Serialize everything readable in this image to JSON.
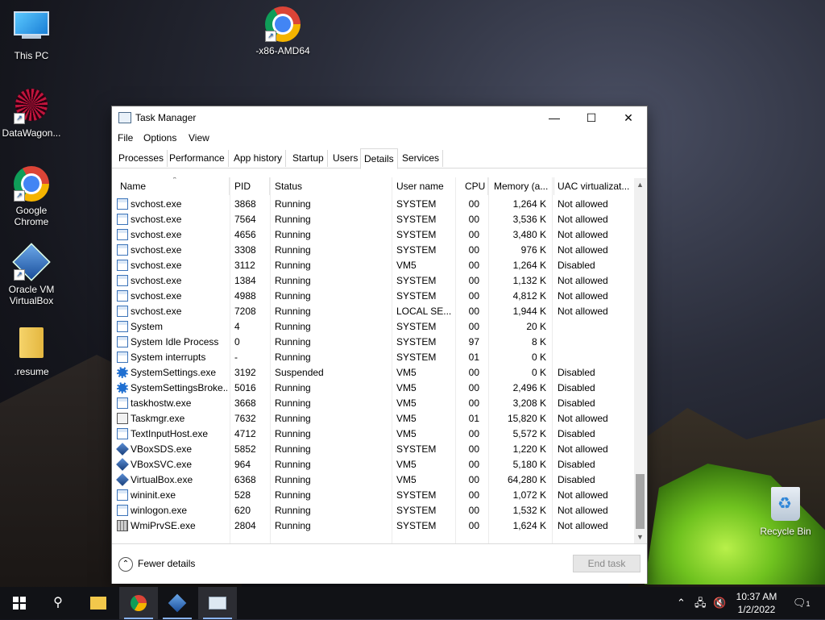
{
  "desktop": {
    "icons": [
      {
        "label": "This PC",
        "icon": "this-pc-icon"
      },
      {
        "label": "-x86-AMD64",
        "icon": "chrome-icon"
      },
      {
        "label": "DataWagon...",
        "icon": "datawagon-icon"
      },
      {
        "label": "Google Chrome",
        "icon": "chrome-icon"
      },
      {
        "label": "Oracle VM VirtualBox",
        "icon": "virtualbox-icon"
      },
      {
        "label": ".resume",
        "icon": "folder-icon"
      },
      {
        "label": "Recycle Bin",
        "icon": "recycle-bin-icon"
      }
    ]
  },
  "window": {
    "title": "Task Manager",
    "menu": [
      "File",
      "Options",
      "View"
    ],
    "tabs": [
      "Processes",
      "Performance",
      "App history",
      "Startup",
      "Users",
      "Details",
      "Services"
    ],
    "active_tab": "Details",
    "columns": [
      "Name",
      "PID",
      "Status",
      "User name",
      "CPU",
      "Memory (a...",
      "UAC virtualizat..."
    ],
    "rows": [
      {
        "name": "svchost.exe",
        "pid": "3868",
        "status": "Running",
        "user": "SYSTEM",
        "cpu": "00",
        "mem": "1,264 K",
        "uac": "Not allowed",
        "icon": "svc"
      },
      {
        "name": "svchost.exe",
        "pid": "7564",
        "status": "Running",
        "user": "SYSTEM",
        "cpu": "00",
        "mem": "3,536 K",
        "uac": "Not allowed",
        "icon": "svc"
      },
      {
        "name": "svchost.exe",
        "pid": "4656",
        "status": "Running",
        "user": "SYSTEM",
        "cpu": "00",
        "mem": "3,480 K",
        "uac": "Not allowed",
        "icon": "svc"
      },
      {
        "name": "svchost.exe",
        "pid": "3308",
        "status": "Running",
        "user": "SYSTEM",
        "cpu": "00",
        "mem": "976 K",
        "uac": "Not allowed",
        "icon": "svc"
      },
      {
        "name": "svchost.exe",
        "pid": "3112",
        "status": "Running",
        "user": "VM5",
        "cpu": "00",
        "mem": "1,264 K",
        "uac": "Disabled",
        "icon": "svc"
      },
      {
        "name": "svchost.exe",
        "pid": "1384",
        "status": "Running",
        "user": "SYSTEM",
        "cpu": "00",
        "mem": "1,132 K",
        "uac": "Not allowed",
        "icon": "svc"
      },
      {
        "name": "svchost.exe",
        "pid": "4988",
        "status": "Running",
        "user": "SYSTEM",
        "cpu": "00",
        "mem": "4,812 K",
        "uac": "Not allowed",
        "icon": "svc"
      },
      {
        "name": "svchost.exe",
        "pid": "7208",
        "status": "Running",
        "user": "LOCAL SE...",
        "cpu": "00",
        "mem": "1,944 K",
        "uac": "Not allowed",
        "icon": "svc"
      },
      {
        "name": "System",
        "pid": "4",
        "status": "Running",
        "user": "SYSTEM",
        "cpu": "00",
        "mem": "20 K",
        "uac": "",
        "icon": "svc"
      },
      {
        "name": "System Idle Process",
        "pid": "0",
        "status": "Running",
        "user": "SYSTEM",
        "cpu": "97",
        "mem": "8 K",
        "uac": "",
        "icon": "svc"
      },
      {
        "name": "System interrupts",
        "pid": "-",
        "status": "Running",
        "user": "SYSTEM",
        "cpu": "01",
        "mem": "0 K",
        "uac": "",
        "icon": "svc"
      },
      {
        "name": "SystemSettings.exe",
        "pid": "3192",
        "status": "Suspended",
        "user": "VM5",
        "cpu": "00",
        "mem": "0 K",
        "uac": "Disabled",
        "icon": "gear"
      },
      {
        "name": "SystemSettingsBroke...",
        "pid": "5016",
        "status": "Running",
        "user": "VM5",
        "cpu": "00",
        "mem": "2,496 K",
        "uac": "Disabled",
        "icon": "gear"
      },
      {
        "name": "taskhostw.exe",
        "pid": "3668",
        "status": "Running",
        "user": "VM5",
        "cpu": "00",
        "mem": "3,208 K",
        "uac": "Disabled",
        "icon": "svc"
      },
      {
        "name": "Taskmgr.exe",
        "pid": "7632",
        "status": "Running",
        "user": "VM5",
        "cpu": "01",
        "mem": "15,820 K",
        "uac": "Not allowed",
        "icon": "task"
      },
      {
        "name": "TextInputHost.exe",
        "pid": "4712",
        "status": "Running",
        "user": "VM5",
        "cpu": "00",
        "mem": "5,572 K",
        "uac": "Disabled",
        "icon": "svc"
      },
      {
        "name": "VBoxSDS.exe",
        "pid": "5852",
        "status": "Running",
        "user": "SYSTEM",
        "cpu": "00",
        "mem": "1,220 K",
        "uac": "Not allowed",
        "icon": "vbox"
      },
      {
        "name": "VBoxSVC.exe",
        "pid": "964",
        "status": "Running",
        "user": "VM5",
        "cpu": "00",
        "mem": "5,180 K",
        "uac": "Disabled",
        "icon": "vbox"
      },
      {
        "name": "VirtualBox.exe",
        "pid": "6368",
        "status": "Running",
        "user": "VM5",
        "cpu": "00",
        "mem": "64,280 K",
        "uac": "Disabled",
        "icon": "vbox"
      },
      {
        "name": "wininit.exe",
        "pid": "528",
        "status": "Running",
        "user": "SYSTEM",
        "cpu": "00",
        "mem": "1,072 K",
        "uac": "Not allowed",
        "icon": "svc"
      },
      {
        "name": "winlogon.exe",
        "pid": "620",
        "status": "Running",
        "user": "SYSTEM",
        "cpu": "00",
        "mem": "1,532 K",
        "uac": "Not allowed",
        "icon": "svc"
      },
      {
        "name": "WmiPrvSE.exe",
        "pid": "2804",
        "status": "Running",
        "user": "SYSTEM",
        "cpu": "00",
        "mem": "1,624 K",
        "uac": "Not allowed",
        "icon": "wmi"
      }
    ],
    "footer": {
      "fewer_details": "Fewer details",
      "end_task": "End task"
    }
  },
  "taskbar": {
    "pinned": [
      "start-icon",
      "search-icon",
      "file-explorer-icon",
      "chrome-icon",
      "virtualbox-icon",
      "task-manager-icon"
    ],
    "time": "10:37 AM",
    "date": "1/2/2022",
    "notification_count": "1"
  }
}
